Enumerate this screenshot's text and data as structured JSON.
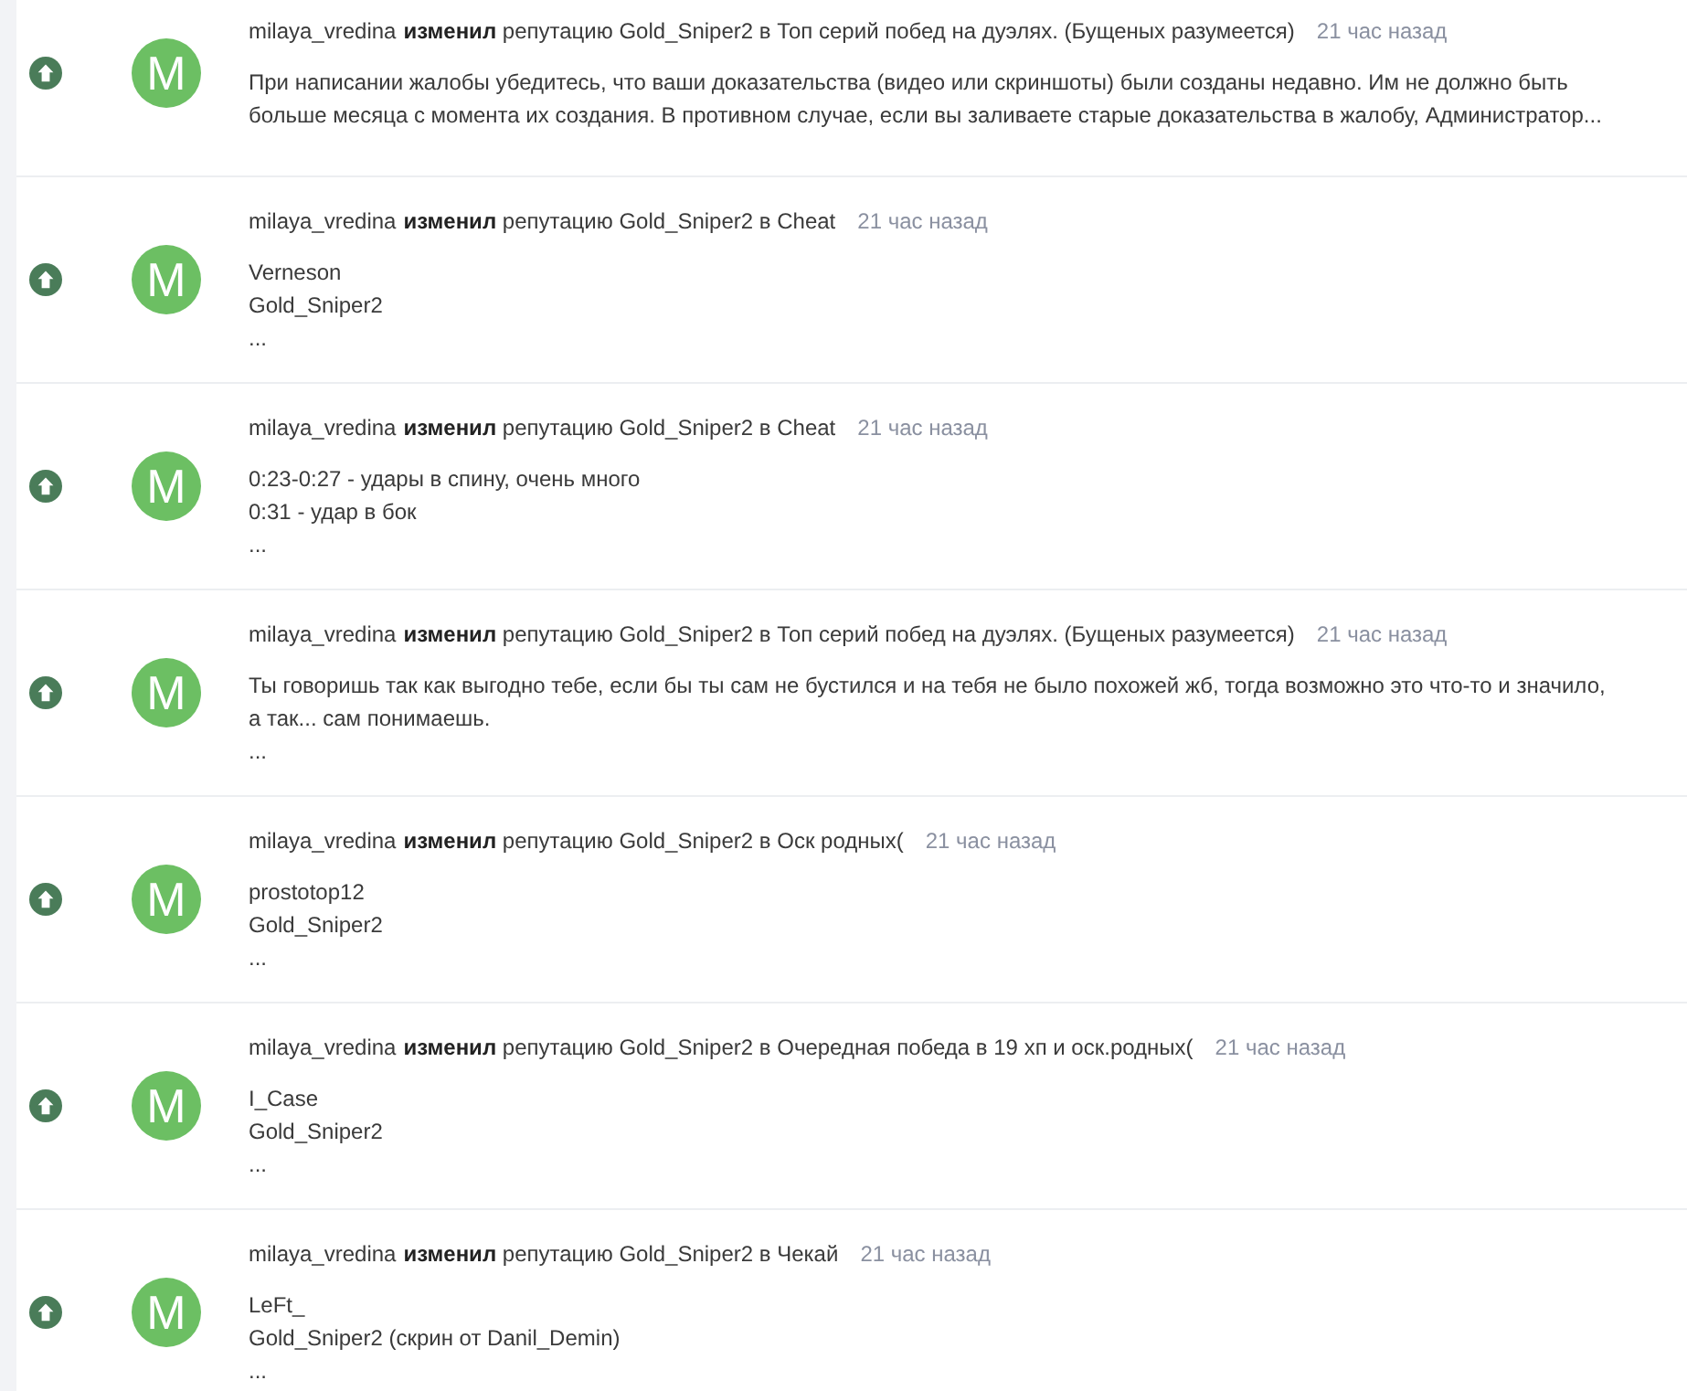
{
  "entries": [
    {
      "initial": "M",
      "user": "milaya_vredina",
      "summary": "**изменил** репутацию Gold_Sniper2 в Топ серий побед на дуэлях. (Бущеных разумеется)",
      "time": "21 час назад",
      "lines": [
        "При написании жалобы убедитесь, что ваши доказательства (видео или скриншоты) были созданы недавно. Им не должно быть",
        "больше месяца с момента их создания. В противном случае, если вы заливаете старые доказательства в жалобу, Администратор..."
      ]
    },
    {
      "initial": "M",
      "user": "milaya_vredina",
      "summary": "**изменил** репутацию Gold_Sniper2 в Cheat",
      "time": "21 час назад",
      "lines": [
        "Verneson",
        "Gold_Sniper2",
        "..."
      ]
    },
    {
      "initial": "M",
      "user": "milaya_vredina",
      "summary": "**изменил** репутацию Gold_Sniper2 в Cheat",
      "time": "21 час назад",
      "lines": [
        "0:23-0:27 - удары в спину, очень много",
        "0:31 - удар в бок",
        "..."
      ]
    },
    {
      "initial": "M",
      "user": "milaya_vredina",
      "summary": "**изменил** репутацию Gold_Sniper2 в Топ серий побед на дуэлях. (Бущеных разумеется)",
      "time": "21 час назад",
      "lines": [
        "Ты говоришь так как выгодно тебе, если бы ты сам не бустился и на тебя не было похожей жб, тогда  возможно это что-то и значило,",
        "а так... сам понимаешь.",
        "..."
      ]
    },
    {
      "initial": "M",
      "user": "milaya_vredina",
      "summary": "**изменил** репутацию Gold_Sniper2 в Оск родных(",
      "time": "21 час назад",
      "lines": [
        "prostotop12",
        "Gold_Sniper2",
        "..."
      ]
    },
    {
      "initial": "M",
      "user": "milaya_vredina",
      "summary": "**изменил** репутацию Gold_Sniper2 в Очередная победа в 19 хп и оск.родных(",
      "time": "21 час назад",
      "lines": [
        "I_Case",
        "Gold_Sniper2",
        "..."
      ]
    },
    {
      "initial": "M",
      "user": "milaya_vredina",
      "summary": "**изменил** репутацию Gold_Sniper2 в Чекай",
      "time": "21 час назад",
      "lines": [
        "LeFt_",
        "Gold_Sniper2 (скрин от Danil_Demin)",
        "..."
      ]
    }
  ]
}
